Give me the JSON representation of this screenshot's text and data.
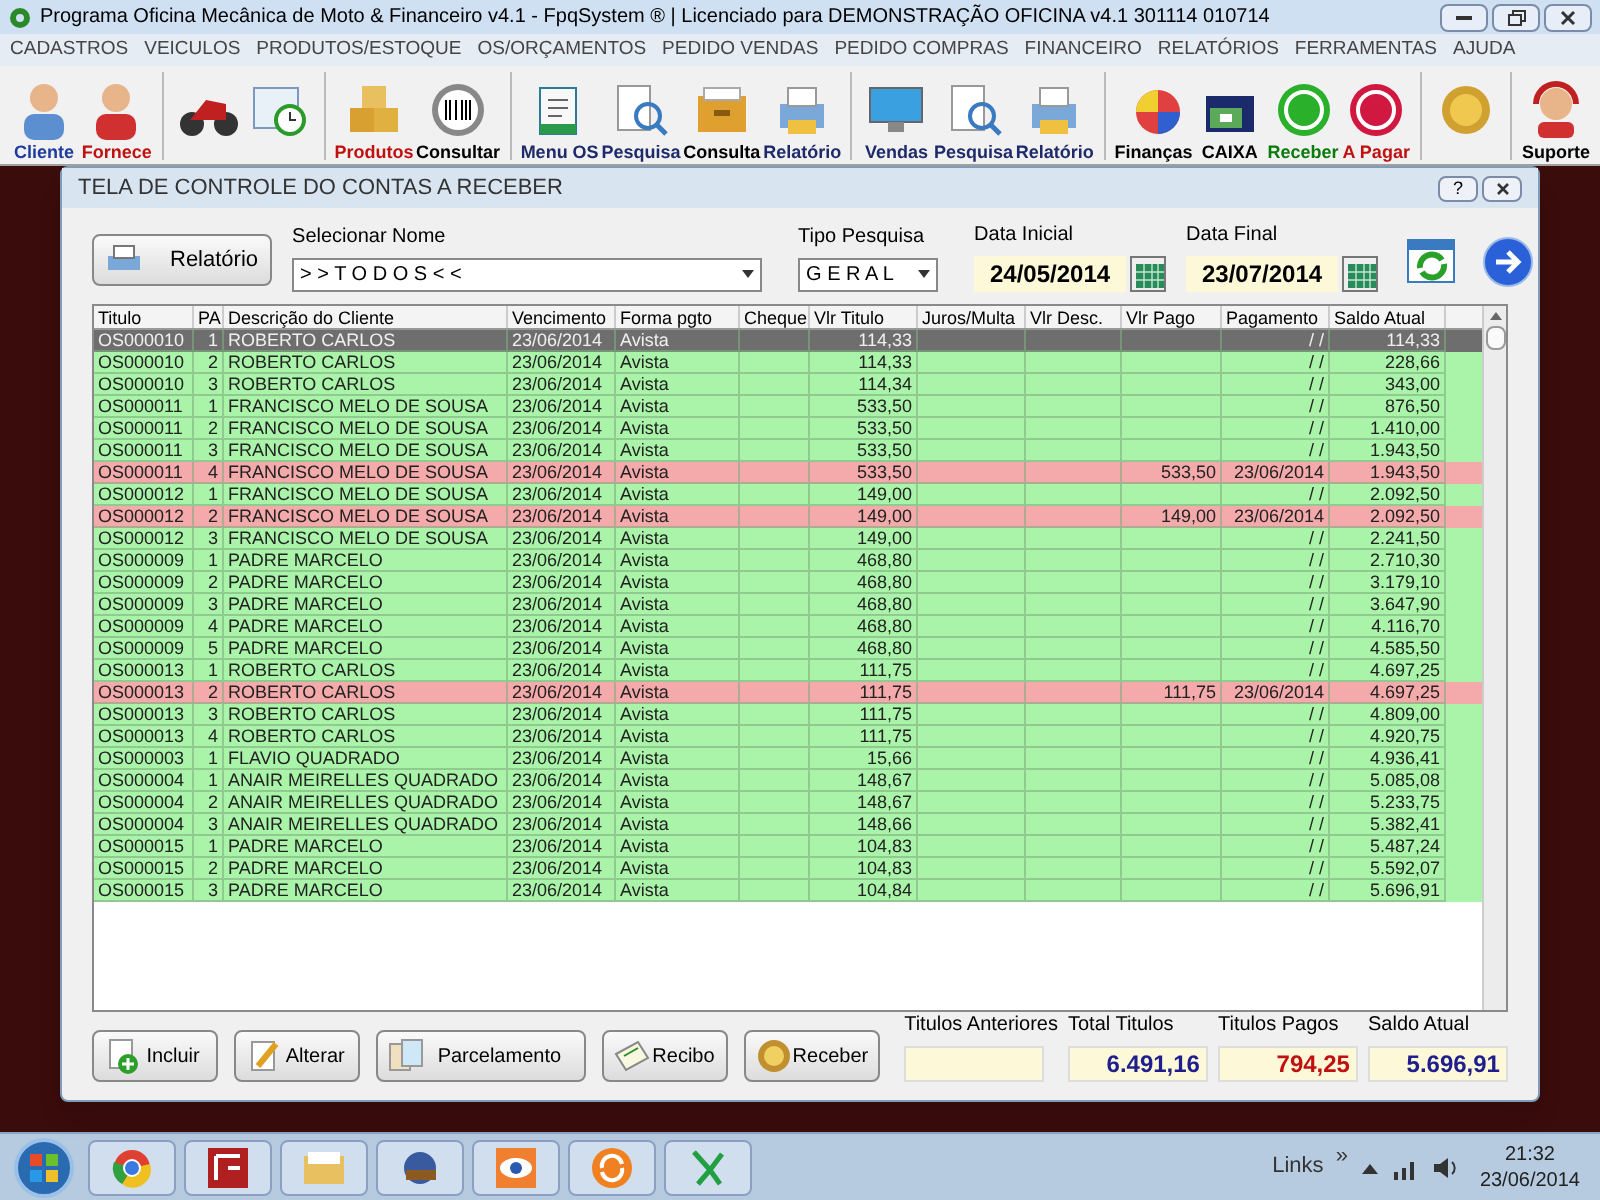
{
  "window": {
    "title": "Programa Oficina Mecânica de Moto & Financeiro v4.1 - FpqSystem ® | Licenciado para  DEMONSTRAÇÃO OFICINA v4.1 301114 010714"
  },
  "menu": [
    "CADASTROS",
    "VEICULOS",
    "PRODUTOS/ESTOQUE",
    "OS/ORÇAMENTOS",
    "PEDIDO VENDAS",
    "PEDIDO COMPRAS",
    "FINANCEIRO",
    "RELATÓRIOS",
    "FERRAMENTAS",
    "AJUDA"
  ],
  "toolbar": [
    {
      "kind": "labeled",
      "label": "Cliente",
      "color": "#1e3c9c",
      "group_break": false
    },
    {
      "kind": "labeled",
      "label": "Fornece",
      "color": "#c01010",
      "group_break": false
    },
    {
      "kind": "icon",
      "group_break": true
    },
    {
      "kind": "icon",
      "group_break": false
    },
    {
      "kind": "labeled",
      "label": "Produtos",
      "color": "#c01010",
      "group_break": true
    },
    {
      "kind": "labeled",
      "label": "Consultar",
      "color": "#000000",
      "group_break": false
    },
    {
      "kind": "labeled",
      "label": "Menu OS",
      "color": "#1e2a6a",
      "group_break": true
    },
    {
      "kind": "labeled",
      "label": "Pesquisa",
      "color": "#1e2a6a",
      "group_break": false
    },
    {
      "kind": "labeled",
      "label": "Consulta",
      "color": "#000000",
      "group_break": false
    },
    {
      "kind": "labeled",
      "label": "Relatório",
      "color": "#1e2a6a",
      "group_break": false
    },
    {
      "kind": "labeled",
      "label": "Vendas",
      "color": "#1e2a6a",
      "group_break": true
    },
    {
      "kind": "labeled",
      "label": "Pesquisa",
      "color": "#1e2a6a",
      "group_break": false
    },
    {
      "kind": "labeled",
      "label": "Relatório",
      "color": "#1e2a6a",
      "group_break": false
    },
    {
      "kind": "labeled",
      "label": "Finanças",
      "color": "#000000",
      "group_break": true
    },
    {
      "kind": "labeled",
      "label": "CAIXA",
      "color": "#000000",
      "group_break": false
    },
    {
      "kind": "labeled",
      "label": "Receber",
      "color": "#0a7a0a",
      "group_break": false
    },
    {
      "kind": "labeled",
      "label": "A Pagar",
      "color": "#c01010",
      "group_break": false
    },
    {
      "kind": "icon",
      "group_break": true
    },
    {
      "kind": "labeled",
      "label": "Suporte",
      "color": "#000000",
      "group_break": true
    }
  ],
  "dialog": {
    "title": "TELA DE CONTROLE DO CONTAS A RECEBER",
    "help_button": "?",
    "report_button": "Relatório",
    "name_label": "Selecionar Nome",
    "name_value": "> > T O D O S < <",
    "type_label": "Tipo  Pesquisa",
    "type_value": "G E R A L",
    "start_label": "Data Inicial",
    "start_value": "24/05/2014",
    "end_label": "Data Final",
    "end_value": "23/07/2014",
    "table": {
      "columns": [
        "Titulo",
        "PA",
        "Descrição do Cliente",
        "Vencimento",
        "Forma pgto",
        "Cheque",
        "Vlr Titulo",
        "Juros/Multa",
        "Vlr Desc.",
        "Vlr Pago",
        "Pagamento",
        "Saldo Atual"
      ],
      "rows": [
        {
          "titulo": "OS000010",
          "pa": "1",
          "cliente": "ROBERTO CARLOS",
          "vencimento": "23/06/2014",
          "forma": "Avista",
          "valor": "114,33",
          "pagamento": "/ /",
          "saldo": "114,33",
          "paid": false,
          "selected": true
        },
        {
          "titulo": "OS000010",
          "pa": "2",
          "cliente": "ROBERTO CARLOS",
          "vencimento": "23/06/2014",
          "forma": "Avista",
          "valor": "114,33",
          "pagamento": "/ /",
          "saldo": "228,66",
          "paid": false,
          "selected": false
        },
        {
          "titulo": "OS000010",
          "pa": "3",
          "cliente": "ROBERTO CARLOS",
          "vencimento": "23/06/2014",
          "forma": "Avista",
          "valor": "114,34",
          "pagamento": "/ /",
          "saldo": "343,00",
          "paid": false,
          "selected": false
        },
        {
          "titulo": "OS000011",
          "pa": "1",
          "cliente": "FRANCISCO MELO DE SOUSA",
          "vencimento": "23/06/2014",
          "forma": "Avista",
          "valor": "533,50",
          "pagamento": "/ /",
          "saldo": "876,50",
          "paid": false,
          "selected": false
        },
        {
          "titulo": "OS000011",
          "pa": "2",
          "cliente": "FRANCISCO MELO DE SOUSA",
          "vencimento": "23/06/2014",
          "forma": "Avista",
          "valor": "533,50",
          "pagamento": "/ /",
          "saldo": "1.410,00",
          "paid": false,
          "selected": false
        },
        {
          "titulo": "OS000011",
          "pa": "3",
          "cliente": "FRANCISCO MELO DE SOUSA",
          "vencimento": "23/06/2014",
          "forma": "Avista",
          "valor": "533,50",
          "pagamento": "/ /",
          "saldo": "1.943,50",
          "paid": false,
          "selected": false
        },
        {
          "titulo": "OS000011",
          "pa": "4",
          "cliente": "FRANCISCO MELO DE SOUSA",
          "vencimento": "23/06/2014",
          "forma": "Avista",
          "valor": "533,50",
          "pago": "533,50",
          "pagamento": "23/06/2014",
          "saldo": "1.943,50",
          "paid": true,
          "selected": false
        },
        {
          "titulo": "OS000012",
          "pa": "1",
          "cliente": "FRANCISCO MELO DE SOUSA",
          "vencimento": "23/06/2014",
          "forma": "Avista",
          "valor": "149,00",
          "pagamento": "/ /",
          "saldo": "2.092,50",
          "paid": false,
          "selected": false
        },
        {
          "titulo": "OS000012",
          "pa": "2",
          "cliente": "FRANCISCO MELO DE SOUSA",
          "vencimento": "23/06/2014",
          "forma": "Avista",
          "valor": "149,00",
          "pago": "149,00",
          "pagamento": "23/06/2014",
          "saldo": "2.092,50",
          "paid": true,
          "selected": false
        },
        {
          "titulo": "OS000012",
          "pa": "3",
          "cliente": "FRANCISCO MELO DE SOUSA",
          "vencimento": "23/06/2014",
          "forma": "Avista",
          "valor": "149,00",
          "pagamento": "/ /",
          "saldo": "2.241,50",
          "paid": false,
          "selected": false
        },
        {
          "titulo": "OS000009",
          "pa": "1",
          "cliente": "PADRE MARCELO",
          "vencimento": "23/06/2014",
          "forma": "Avista",
          "valor": "468,80",
          "pagamento": "/ /",
          "saldo": "2.710,30",
          "paid": false,
          "selected": false
        },
        {
          "titulo": "OS000009",
          "pa": "2",
          "cliente": "PADRE MARCELO",
          "vencimento": "23/06/2014",
          "forma": "Avista",
          "valor": "468,80",
          "pagamento": "/ /",
          "saldo": "3.179,10",
          "paid": false,
          "selected": false
        },
        {
          "titulo": "OS000009",
          "pa": "3",
          "cliente": "PADRE MARCELO",
          "vencimento": "23/06/2014",
          "forma": "Avista",
          "valor": "468,80",
          "pagamento": "/ /",
          "saldo": "3.647,90",
          "paid": false,
          "selected": false
        },
        {
          "titulo": "OS000009",
          "pa": "4",
          "cliente": "PADRE MARCELO",
          "vencimento": "23/06/2014",
          "forma": "Avista",
          "valor": "468,80",
          "pagamento": "/ /",
          "saldo": "4.116,70",
          "paid": false,
          "selected": false
        },
        {
          "titulo": "OS000009",
          "pa": "5",
          "cliente": "PADRE MARCELO",
          "vencimento": "23/06/2014",
          "forma": "Avista",
          "valor": "468,80",
          "pagamento": "/ /",
          "saldo": "4.585,50",
          "paid": false,
          "selected": false
        },
        {
          "titulo": "OS000013",
          "pa": "1",
          "cliente": "ROBERTO CARLOS",
          "vencimento": "23/06/2014",
          "forma": "Avista",
          "valor": "111,75",
          "pagamento": "/ /",
          "saldo": "4.697,25",
          "paid": false,
          "selected": false
        },
        {
          "titulo": "OS000013",
          "pa": "2",
          "cliente": "ROBERTO CARLOS",
          "vencimento": "23/06/2014",
          "forma": "Avista",
          "valor": "111,75",
          "pago": "111,75",
          "pagamento": "23/06/2014",
          "saldo": "4.697,25",
          "paid": true,
          "selected": false
        },
        {
          "titulo": "OS000013",
          "pa": "3",
          "cliente": "ROBERTO CARLOS",
          "vencimento": "23/06/2014",
          "forma": "Avista",
          "valor": "111,75",
          "pagamento": "/ /",
          "saldo": "4.809,00",
          "paid": false,
          "selected": false
        },
        {
          "titulo": "OS000013",
          "pa": "4",
          "cliente": "ROBERTO CARLOS",
          "vencimento": "23/06/2014",
          "forma": "Avista",
          "valor": "111,75",
          "pagamento": "/ /",
          "saldo": "4.920,75",
          "paid": false,
          "selected": false
        },
        {
          "titulo": "OS000003",
          "pa": "1",
          "cliente": "FLAVIO QUADRADO",
          "vencimento": "23/06/2014",
          "forma": "Avista",
          "valor": "15,66",
          "pagamento": "/ /",
          "saldo": "4.936,41",
          "paid": false,
          "selected": false
        },
        {
          "titulo": "OS000004",
          "pa": "1",
          "cliente": "ANAIR MEIRELLES QUADRADO",
          "vencimento": "23/06/2014",
          "forma": "Avista",
          "valor": "148,67",
          "pagamento": "/ /",
          "saldo": "5.085,08",
          "paid": false,
          "selected": false
        },
        {
          "titulo": "OS000004",
          "pa": "2",
          "cliente": "ANAIR MEIRELLES QUADRADO",
          "vencimento": "23/06/2014",
          "forma": "Avista",
          "valor": "148,67",
          "pagamento": "/ /",
          "saldo": "5.233,75",
          "paid": false,
          "selected": false
        },
        {
          "titulo": "OS000004",
          "pa": "3",
          "cliente": "ANAIR MEIRELLES QUADRADO",
          "vencimento": "23/06/2014",
          "forma": "Avista",
          "valor": "148,66",
          "pagamento": "/ /",
          "saldo": "5.382,41",
          "paid": false,
          "selected": false
        },
        {
          "titulo": "OS000015",
          "pa": "1",
          "cliente": "PADRE MARCELO",
          "vencimento": "23/06/2014",
          "forma": "Avista",
          "valor": "104,83",
          "pagamento": "/ /",
          "saldo": "5.487,24",
          "paid": false,
          "selected": false
        },
        {
          "titulo": "OS000015",
          "pa": "2",
          "cliente": "PADRE MARCELO",
          "vencimento": "23/06/2014",
          "forma": "Avista",
          "valor": "104,83",
          "pagamento": "/ /",
          "saldo": "5.592,07",
          "paid": false,
          "selected": false
        },
        {
          "titulo": "OS000015",
          "pa": "3",
          "cliente": "PADRE MARCELO",
          "vencimento": "23/06/2014",
          "forma": "Avista",
          "valor": "104,84",
          "pagamento": "/ /",
          "saldo": "5.696,91",
          "paid": false,
          "selected": false
        }
      ]
    },
    "buttons": [
      "Incluir",
      "Alterar",
      "Parcelamento",
      "Recibo",
      "Receber"
    ],
    "totals": [
      {
        "label": "Titulos Anteriores"
      },
      {
        "label": "Total Titulos",
        "value": "6.491,16",
        "color": "#1e1e8c"
      },
      {
        "label": "Titulos Pagos",
        "value": "794,25",
        "color": "#c01010"
      },
      {
        "label": "Saldo Atual",
        "value": "5.696,91",
        "color": "#1e1e8c"
      }
    ]
  },
  "taskbar": {
    "links": "Links",
    "chevron": "»",
    "time": "21:32",
    "date": "23/06/2014"
  }
}
